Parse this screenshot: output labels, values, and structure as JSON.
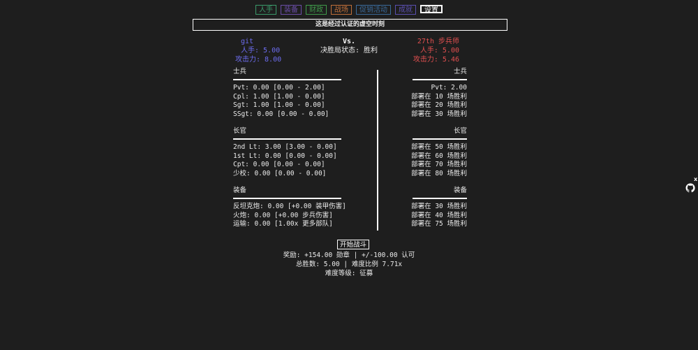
{
  "tabs": [
    {
      "label": "人手",
      "color": "#3a9a6a"
    },
    {
      "label": "装备",
      "color": "#6b4ea8"
    },
    {
      "label": "财政",
      "color": "#3f9a4a"
    },
    {
      "label": "战场",
      "color": "#c0703a"
    },
    {
      "label": "促销活动",
      "color": "#3a6a9a"
    },
    {
      "label": "成就",
      "color": "#5a4fb0"
    },
    {
      "label": "设置",
      "color": "#ffffff"
    }
  ],
  "notice": "这是经过认证的虚空时刻",
  "player": {
    "name": "git",
    "manpower": "人手: 5.00",
    "attack": "攻击力: 8.00"
  },
  "versus": {
    "title": "Vs.",
    "status": "决胜局状态: 胜利"
  },
  "enemy": {
    "name": "27th 步兵师",
    "manpower": "人手: 5.00",
    "attack": "攻击力: 5.46"
  },
  "left": {
    "soldiers": {
      "title": "士兵",
      "rows": [
        "Pvt: 0.00 [0.00 - 2.00]",
        "Cpl: 1.00 [1.00 - 0.00]",
        "Sgt: 1.00 [1.00 - 0.00]",
        "SSgt: 0.00 [0.00 - 0.00]"
      ]
    },
    "officers": {
      "title": "长官",
      "rows": [
        "2nd Lt: 3.00 [3.00 - 0.00]",
        "1st Lt: 0.00 [0.00 - 0.00]",
        "Cpt: 0.00 [0.00 - 0.00]",
        "少校: 0.00 [0.00 - 0.00]"
      ]
    },
    "equipment": {
      "title": "装备",
      "rows": [
        "反坦克炮: 0.00 [+0.00 装甲伤害]",
        "火炮: 0.00 [+0.00 步兵伤害]",
        "运输: 0.00 [1.00x 更多部队]"
      ]
    }
  },
  "right": {
    "soldiers": {
      "title": "士兵",
      "rows": [
        "Pvt: 2.00",
        "部署在 10 场胜利",
        "部署在 20 场胜利",
        "部署在 30 场胜利"
      ]
    },
    "officers": {
      "title": "长官",
      "rows": [
        "部署在 50 场胜利",
        "部署在 60 场胜利",
        "部署在 70 场胜利",
        "部署在 80 场胜利"
      ]
    },
    "equipment": {
      "title": "装备",
      "rows": [
        "部署在 30 场胜利",
        "部署在 40 场胜利",
        "部署在 75 场胜利"
      ]
    }
  },
  "start_button": "开始战斗",
  "reward_line": "奖励: +154.00 勋章 | +/-100.00 认可",
  "stats_line": "总胜数: 5.00 | 难度比例 7.71x",
  "difficulty_line": "难度等级: 征募",
  "side_widget": {
    "close": "x",
    "icon": "github-cat-icon"
  }
}
